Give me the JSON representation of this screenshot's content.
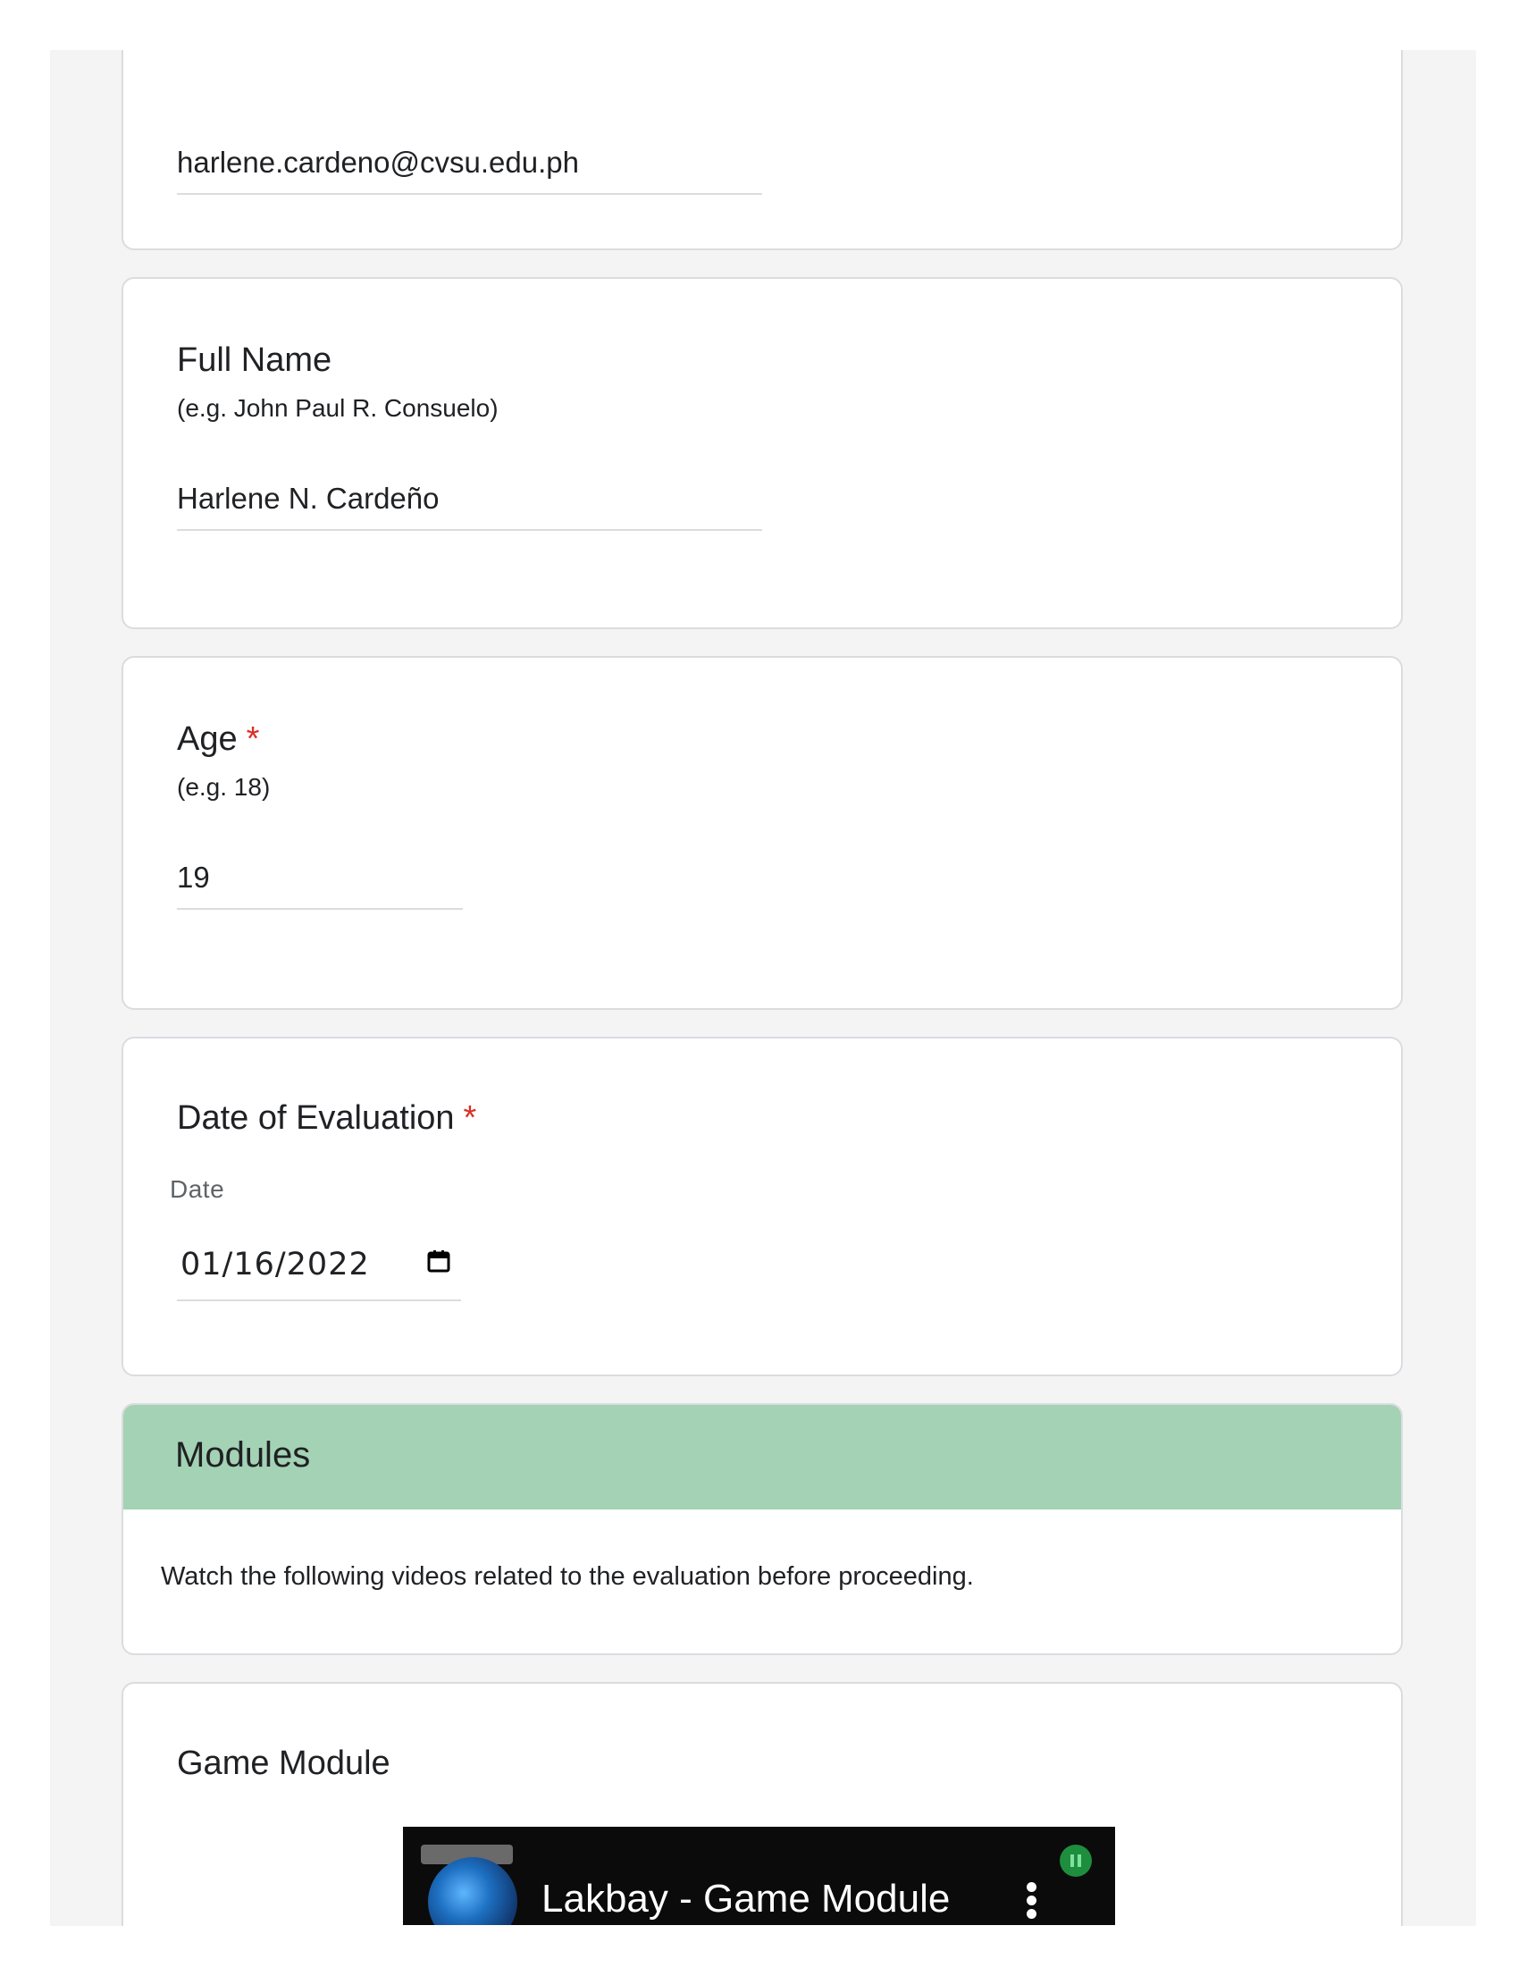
{
  "email": {
    "value": "harlene.cardeno@cvsu.edu.ph"
  },
  "full_name": {
    "title": "Full Name",
    "hint": "(e.g. John Paul R. Consuelo)",
    "value": "Harlene N. Cardeño"
  },
  "age": {
    "title": "Age",
    "required_mark": "*",
    "hint": "(e.g. 18)",
    "value": "19"
  },
  "date_of_evaluation": {
    "title": "Date of Evaluation",
    "required_mark": "*",
    "field_label": "Date",
    "value": "01/16/2022"
  },
  "modules_section": {
    "title": "Modules",
    "description": "Watch the following videos related to the evaluation before proceeding.",
    "header_color": "#a3d2b4"
  },
  "game_module": {
    "title": "Game Module",
    "video": {
      "title": "Lakbay - Game Module"
    }
  },
  "colors": {
    "required": "#d93025",
    "page_background": "#f4f4f4",
    "card_border": "#dadce0"
  }
}
